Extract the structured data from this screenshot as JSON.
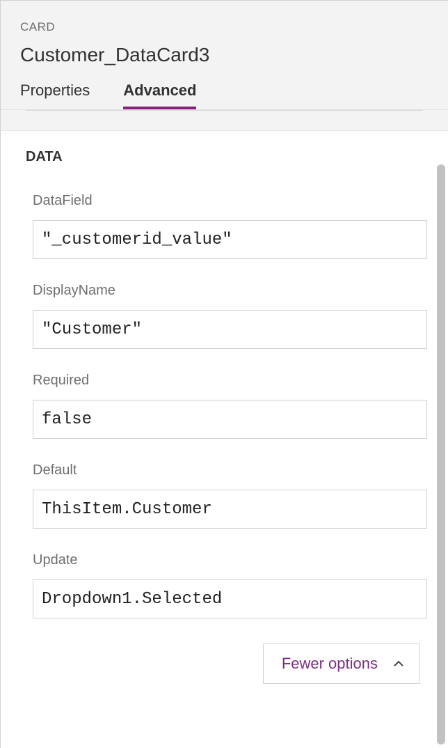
{
  "card": {
    "label": "CARD",
    "name": "Customer_DataCard3"
  },
  "tabs": {
    "properties": "Properties",
    "advanced": "Advanced"
  },
  "section": {
    "data": "DATA"
  },
  "fields": {
    "datafield": {
      "label": "DataField",
      "value": "\"_customerid_value\""
    },
    "displayname": {
      "label": "DisplayName",
      "value": "\"Customer\""
    },
    "required": {
      "label": "Required",
      "value": "false"
    },
    "default": {
      "label": "Default",
      "value": "ThisItem.Customer"
    },
    "update": {
      "label": "Update",
      "value": "Dropdown1.Selected"
    }
  },
  "buttons": {
    "fewer_options": "Fewer options"
  }
}
